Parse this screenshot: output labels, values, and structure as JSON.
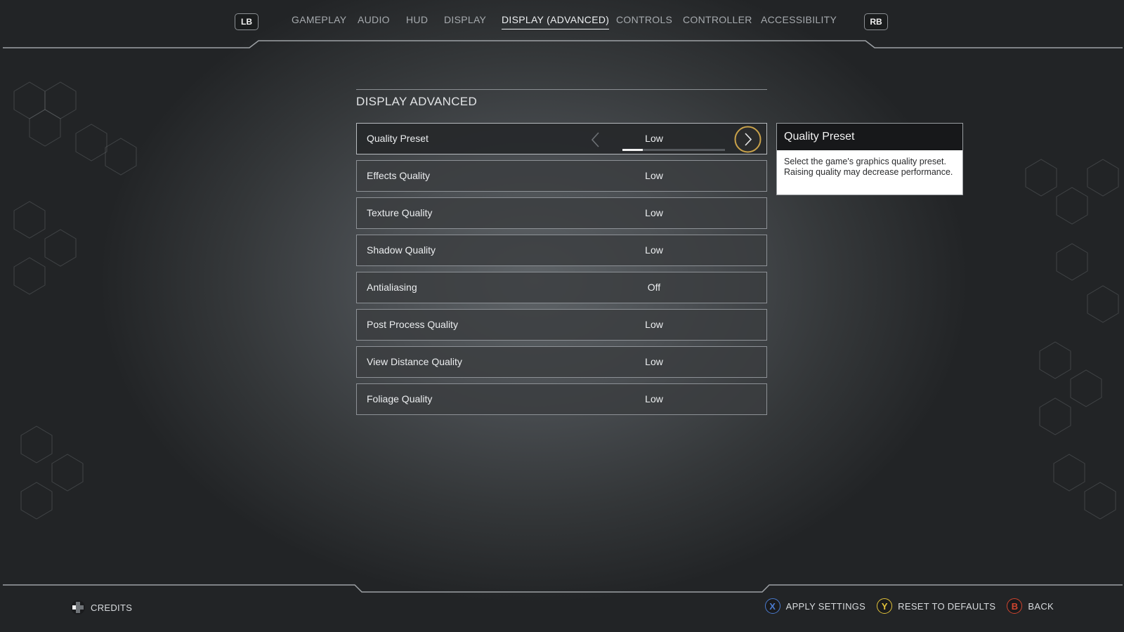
{
  "nav": {
    "left_bumper": "LB",
    "right_bumper": "RB",
    "tabs": [
      {
        "label": "GAMEPLAY",
        "active": false
      },
      {
        "label": "AUDIO",
        "active": false
      },
      {
        "label": "HUD",
        "active": false
      },
      {
        "label": "DISPLAY",
        "active": false
      },
      {
        "label": "DISPLAY (ADVANCED)",
        "active": true
      },
      {
        "label": "CONTROLS",
        "active": false
      },
      {
        "label": "CONTROLLER",
        "active": false
      },
      {
        "label": "ACCESSIBILITY",
        "active": false
      }
    ]
  },
  "section": {
    "title": "DISPLAY ADVANCED"
  },
  "settings": [
    {
      "label": "Quality Preset",
      "value": "Low",
      "selected": true,
      "preset_progress": 0.2
    },
    {
      "label": "Effects Quality",
      "value": "Low"
    },
    {
      "label": "Texture Quality",
      "value": "Low"
    },
    {
      "label": "Shadow Quality",
      "value": "Low"
    },
    {
      "label": "Antialiasing",
      "value": "Off"
    },
    {
      "label": "Post Process Quality",
      "value": "Low"
    },
    {
      "label": "View Distance Quality",
      "value": "Low"
    },
    {
      "label": "Foliage Quality",
      "value": "Low"
    }
  ],
  "info_panel": {
    "title": "Quality Preset",
    "description": "Select the game's graphics quality preset. Raising quality may decrease performance."
  },
  "footer": {
    "credits_label": "CREDITS",
    "credits_icon": "dpad-icon",
    "actions": [
      {
        "glyph": "X",
        "label": "APPLY SETTINGS",
        "color": "#4a7bd0"
      },
      {
        "glyph": "Y",
        "label": "RESET TO DEFAULTS",
        "color": "#e3c33a"
      },
      {
        "glyph": "B",
        "label": "BACK",
        "color": "#d0452f"
      }
    ]
  },
  "colors": {
    "accent_gold": "#c9a24a",
    "background": "#4b4f53"
  }
}
